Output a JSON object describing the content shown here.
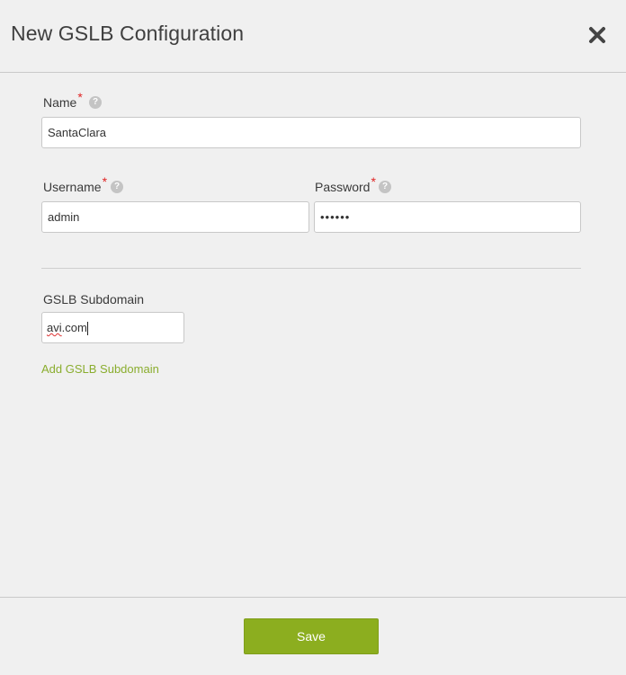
{
  "dialog": {
    "title": "New GSLB Configuration"
  },
  "form": {
    "name": {
      "label": "Name",
      "required": "*",
      "value": "SantaClara",
      "help": "?"
    },
    "username": {
      "label": "Username",
      "required": "*",
      "value": "admin",
      "help": "?"
    },
    "password": {
      "label": "Password",
      "required": "*",
      "value": "••••••",
      "help": "?"
    },
    "subdomain": {
      "label": "GSLB Subdomain",
      "value_part1": "avi",
      "value_part2": ".com"
    },
    "add_subdomain_link": "Add GSLB Subdomain"
  },
  "footer": {
    "save_label": "Save"
  },
  "colors": {
    "accent": "#8cae1f",
    "link": "#8aad2e",
    "required": "#e02424"
  }
}
